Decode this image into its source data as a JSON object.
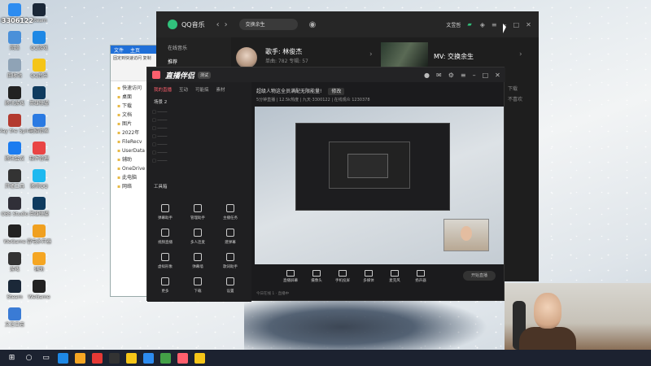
{
  "desktop": {
    "account_number": "3306122",
    "icons": [
      {
        "label": "360安全卫士",
        "color": "#2d8cf0"
      },
      {
        "label": "Steam",
        "color": "#1b2838"
      },
      {
        "label": "网络",
        "color": "#4a90d9"
      },
      {
        "label": "QQ游戏",
        "color": "#1e88e5"
      },
      {
        "label": "回收站",
        "color": "#8fa3b6"
      },
      {
        "label": "QQ音乐",
        "color": "#f5c518"
      },
      {
        "label": "腾讯游戏",
        "color": "#222222"
      },
      {
        "label": "英雄联盟",
        "color": "#0f3b5f"
      },
      {
        "label": "Slay the Spire",
        "color": "#b33a2f"
      },
      {
        "label": "电脑管家",
        "color": "#2a7ae2"
      },
      {
        "label": "腾讯会议",
        "color": "#1b7cf0"
      },
      {
        "label": "软件管理",
        "color": "#e94545"
      },
      {
        "label": "开播工具",
        "color": "#333333"
      },
      {
        "label": "腾讯QQ",
        "color": "#1eb9f0"
      },
      {
        "label": "OBS Studio",
        "color": "#302f38"
      },
      {
        "label": "英雄联盟",
        "color": "#0f3b5f"
      },
      {
        "label": "WeGame",
        "color": "#222222"
      },
      {
        "label": "雷电多开器",
        "color": "#f0a020"
      },
      {
        "label": "游戏",
        "color": "#333333"
      },
      {
        "label": "辅助",
        "color": "#f5a623"
      },
      {
        "label": "Steam",
        "color": "#1b2838"
      },
      {
        "label": "WeGame",
        "color": "#222222"
      },
      {
        "label": "文艺日志",
        "color": "#3a7bd5"
      }
    ]
  },
  "explorer": {
    "tabs": [
      "文件",
      "主页"
    ],
    "ribbon": "固定到快速访问  复制",
    "nav": [
      "快速访问",
      "桌面",
      "下载",
      "文档",
      "图片",
      "2022年",
      "FileRecv",
      "UserData",
      "辅助",
      "OneDrive",
      "此电脑",
      "网络"
    ]
  },
  "qqmusic": {
    "app_name": "QQ音乐",
    "search_value": "交换余生",
    "side_label": "在线音乐",
    "side_item": "推荐",
    "singer": "歌手: 林俊杰",
    "singer_meta": "单曲: 782    专辑: 57",
    "mv_title": "MV: 交换余生",
    "user": "文昱哲",
    "right_col": [
      "下载",
      "不喜欢"
    ]
  },
  "live": {
    "logo": "直播伴侣",
    "version": "测试",
    "tabs": [
      "我的直播",
      "互动",
      "可能搞",
      "素材"
    ],
    "scene_label": "场景 2",
    "title": "超级人物这全员满配无限能量!",
    "title_tag": "修改",
    "info": "5分钟直播 | 12.5k热度 | 九天·3300122 | 在线观众 1230378",
    "tools_header": "工具箱",
    "tools": [
      "弹幕助手",
      "管理助手",
      "主播任务",
      "视频直播",
      "多人连麦",
      "建弹幕",
      "虚拟形象",
      "弹幕墙",
      "歌词助手",
      "更多",
      "下载",
      "设置"
    ],
    "bottom": [
      "直播屏幕",
      "摄像头",
      "手机投屏",
      "多媒体",
      "麦克风",
      "扬声器"
    ],
    "go_live": "开始直播",
    "status": "今日在线 1  ·  直播中"
  }
}
